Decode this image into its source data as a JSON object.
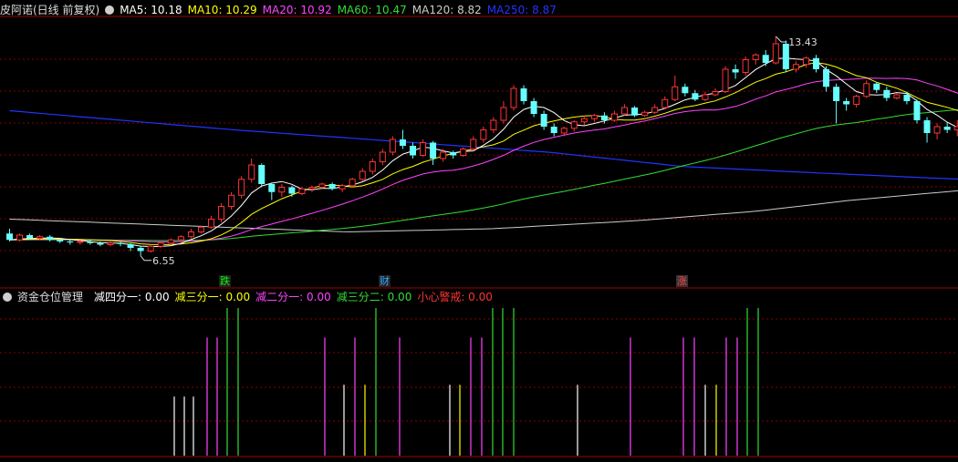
{
  "header": {
    "title": "皮阿诺(日线 前复权)",
    "gear_icon": "gear-icon",
    "ma_labels": [
      {
        "text": "MA5: 10.18",
        "color": "#ffffff"
      },
      {
        "text": "MA10: 10.29",
        "color": "#ffff00"
      },
      {
        "text": "MA20: 10.92",
        "color": "#ff44ff"
      },
      {
        "text": "MA60: 10.47",
        "color": "#33dd33"
      },
      {
        "text": "MA120: 8.82",
        "color": "#cccccc"
      },
      {
        "text": "MA250: 8.87",
        "color": "#2233ff"
      }
    ]
  },
  "price_annotations": {
    "high": "13.43",
    "low": "6.55"
  },
  "markers": [
    {
      "text": "跌",
      "color": "#00ff00",
      "bg": "#222"
    },
    {
      "text": "财",
      "color": "#33aaff",
      "bg": "#222"
    },
    {
      "text": "涨",
      "color": "#ff4444",
      "bg": "#333"
    }
  ],
  "indicator": {
    "title": "资金仓位管理",
    "values": [
      {
        "text": "减四分一: 0.00",
        "color": "#ffffff"
      },
      {
        "text": "减三分一: 0.00",
        "color": "#ffff00"
      },
      {
        "text": "减二分一: 0.00",
        "color": "#ff44ff"
      },
      {
        "text": "减三分二: 0.00",
        "color": "#33dd33"
      },
      {
        "text": "小心警戒: 0.00",
        "color": "#ff3333"
      }
    ]
  },
  "colors": {
    "up": "#ff3333",
    "down": "#66ffff",
    "grid": "#8b0000",
    "axis": "#a00000"
  },
  "chart_data": {
    "type": "candlestick",
    "y_range": [
      6.0,
      14.0
    ],
    "candles": [
      [
        7.25,
        7.05,
        7.4,
        7.0
      ],
      [
        7.05,
        7.2,
        7.25,
        7.0
      ],
      [
        7.2,
        7.1,
        7.25,
        7.05
      ],
      [
        7.1,
        7.15,
        7.2,
        7.05
      ],
      [
        7.15,
        7.05,
        7.2,
        7.0
      ],
      [
        7.05,
        7.0,
        7.1,
        6.95
      ],
      [
        7.0,
        6.98,
        7.05,
        6.9
      ],
      [
        6.98,
        7.0,
        7.05,
        6.9
      ],
      [
        7.0,
        6.95,
        7.05,
        6.9
      ],
      [
        6.95,
        6.9,
        7.0,
        6.85
      ],
      [
        6.9,
        6.95,
        7.0,
        6.85
      ],
      [
        6.95,
        6.92,
        7.0,
        6.85
      ],
      [
        6.92,
        6.8,
        6.95,
        6.7
      ],
      [
        6.8,
        6.7,
        6.85,
        6.55
      ],
      [
        6.7,
        6.85,
        6.9,
        6.65
      ],
      [
        6.85,
        6.95,
        7.0,
        6.8
      ],
      [
        6.95,
        7.05,
        7.1,
        6.9
      ],
      [
        7.05,
        7.15,
        7.2,
        7.0
      ],
      [
        7.15,
        7.3,
        7.4,
        7.1
      ],
      [
        7.3,
        7.45,
        7.5,
        7.25
      ],
      [
        7.45,
        7.7,
        7.8,
        7.4
      ],
      [
        7.7,
        8.1,
        8.2,
        7.6
      ],
      [
        8.1,
        8.45,
        8.55,
        8.0
      ],
      [
        8.45,
        8.95,
        9.05,
        8.35
      ],
      [
        8.95,
        9.4,
        9.6,
        8.85
      ],
      [
        9.4,
        8.8,
        9.45,
        8.7
      ],
      [
        8.8,
        8.55,
        8.85,
        8.3
      ],
      [
        8.55,
        8.7,
        8.8,
        8.4
      ],
      [
        8.7,
        8.5,
        8.75,
        8.4
      ],
      [
        8.5,
        8.65,
        8.7,
        8.45
      ],
      [
        8.65,
        8.7,
        8.75,
        8.55
      ],
      [
        8.7,
        8.8,
        8.85,
        8.65
      ],
      [
        8.8,
        8.65,
        8.85,
        8.6
      ],
      [
        8.65,
        8.75,
        8.8,
        8.55
      ],
      [
        8.75,
        8.95,
        9.0,
        8.7
      ],
      [
        8.95,
        9.2,
        9.3,
        8.9
      ],
      [
        9.2,
        9.5,
        9.6,
        9.1
      ],
      [
        9.5,
        9.8,
        9.9,
        9.4
      ],
      [
        9.8,
        10.2,
        10.3,
        9.7
      ],
      [
        10.2,
        10.0,
        10.5,
        9.9
      ],
      [
        10.0,
        9.7,
        10.1,
        9.6
      ],
      [
        9.7,
        10.1,
        10.2,
        9.65
      ],
      [
        10.1,
        9.6,
        10.15,
        9.4
      ],
      [
        9.6,
        9.8,
        9.9,
        9.5
      ],
      [
        9.8,
        9.7,
        9.85,
        9.6
      ],
      [
        9.7,
        9.9,
        9.95,
        9.65
      ],
      [
        9.9,
        10.2,
        10.3,
        9.85
      ],
      [
        10.2,
        10.5,
        10.6,
        10.1
      ],
      [
        10.5,
        10.8,
        10.9,
        10.4
      ],
      [
        10.8,
        11.2,
        11.4,
        10.7
      ],
      [
        11.2,
        11.8,
        11.9,
        11.1
      ],
      [
        11.8,
        11.4,
        11.9,
        11.3
      ],
      [
        11.4,
        11.0,
        11.5,
        10.9
      ],
      [
        11.0,
        10.6,
        11.1,
        10.5
      ],
      [
        10.6,
        10.4,
        10.7,
        10.3
      ],
      [
        10.4,
        10.55,
        10.6,
        10.3
      ],
      [
        10.55,
        10.75,
        10.8,
        10.45
      ],
      [
        10.75,
        10.85,
        10.95,
        10.65
      ],
      [
        10.85,
        10.95,
        11.0,
        10.75
      ],
      [
        10.95,
        10.8,
        11.05,
        10.7
      ],
      [
        10.8,
        11.0,
        11.1,
        10.75
      ],
      [
        11.0,
        11.2,
        11.3,
        10.95
      ],
      [
        11.2,
        10.95,
        11.25,
        10.9
      ],
      [
        10.95,
        11.05,
        11.1,
        10.9
      ],
      [
        11.05,
        11.2,
        11.3,
        11.0
      ],
      [
        11.2,
        11.45,
        11.55,
        11.15
      ],
      [
        11.45,
        11.85,
        12.2,
        11.4
      ],
      [
        11.85,
        11.65,
        11.95,
        11.55
      ],
      [
        11.65,
        11.45,
        11.75,
        11.4
      ],
      [
        11.45,
        11.6,
        11.7,
        11.4
      ],
      [
        11.6,
        11.7,
        11.8,
        11.55
      ],
      [
        11.7,
        12.4,
        12.5,
        11.65
      ],
      [
        12.4,
        12.3,
        12.55,
        12.1
      ],
      [
        12.3,
        12.7,
        12.8,
        12.2
      ],
      [
        12.7,
        12.85,
        12.9,
        12.55
      ],
      [
        12.85,
        12.6,
        13.0,
        12.5
      ],
      [
        12.6,
        13.2,
        13.43,
        12.55
      ],
      [
        13.2,
        12.4,
        13.3,
        12.3
      ],
      [
        12.4,
        12.55,
        12.65,
        12.3
      ],
      [
        12.55,
        12.75,
        12.8,
        12.45
      ],
      [
        12.75,
        12.4,
        12.85,
        12.3
      ],
      [
        12.4,
        11.85,
        12.5,
        11.7
      ],
      [
        11.85,
        11.4,
        11.95,
        10.7
      ],
      [
        11.4,
        11.3,
        11.5,
        11.1
      ],
      [
        11.3,
        11.55,
        11.6,
        11.2
      ],
      [
        11.55,
        11.95,
        12.05,
        11.5
      ],
      [
        11.95,
        11.75,
        12.0,
        11.65
      ],
      [
        11.75,
        11.5,
        11.85,
        11.4
      ],
      [
        11.5,
        11.6,
        11.65,
        11.45
      ],
      [
        11.6,
        11.4,
        11.7,
        11.3
      ],
      [
        11.4,
        10.8,
        11.45,
        10.7
      ],
      [
        10.8,
        10.4,
        10.9,
        10.1
      ],
      [
        10.4,
        10.6,
        10.7,
        10.2
      ],
      [
        10.6,
        10.5,
        10.75,
        10.4
      ],
      [
        10.5,
        10.6,
        10.8,
        10.3
      ],
      [
        10.6,
        10.75,
        10.85,
        10.4
      ],
      [
        10.75,
        10.55,
        10.8,
        10.4
      ],
      [
        10.55,
        10.45,
        10.7,
        10.2
      ],
      [
        10.45,
        10.65,
        10.8,
        10.4
      ]
    ],
    "ma250": [
      [
        0,
        11.1
      ],
      [
        50,
        10.5
      ],
      [
        100,
        10.0
      ],
      [
        120,
        9.8
      ],
      [
        150,
        9.35
      ],
      [
        180,
        9.15
      ],
      [
        220,
        8.9
      ]
    ],
    "ma120": [
      [
        0,
        7.7
      ],
      [
        70,
        7.3
      ],
      [
        100,
        7.4
      ],
      [
        130,
        7.65
      ],
      [
        155,
        7.95
      ],
      [
        175,
        8.3
      ],
      [
        190,
        8.5
      ],
      [
        205,
        8.7
      ]
    ],
    "ma60_start": 7.05,
    "indicator_bars": [
      [
        191,
        "#ffffff",
        10
      ],
      [
        202,
        "#ffffff",
        10
      ],
      [
        212,
        "#ffffff",
        10
      ],
      [
        227,
        "#ff44ff",
        20
      ],
      [
        238,
        "#ff44ff",
        20
      ],
      [
        249,
        "#33dd33",
        25
      ],
      [
        261,
        "#33dd33",
        25
      ],
      [
        356,
        "#ff44ff",
        20
      ],
      [
        377,
        "#ffffff",
        12
      ],
      [
        389,
        "#ff44ff",
        20
      ],
      [
        400,
        "#ffff00",
        12
      ],
      [
        412,
        "#33dd33",
        25
      ],
      [
        438,
        "#ff44ff",
        20
      ],
      [
        493,
        "#ffffff",
        12
      ],
      [
        504,
        "#ffff00",
        12
      ],
      [
        516,
        "#ff44ff",
        20
      ],
      [
        528,
        "#ff44ff",
        20
      ],
      [
        540,
        "#33dd33",
        25
      ],
      [
        551,
        "#33dd33",
        25
      ],
      [
        563,
        "#33dd33",
        25
      ],
      [
        633,
        "#ffffff",
        12
      ],
      [
        691,
        "#ff44ff",
        20
      ],
      [
        749,
        "#ff44ff",
        20
      ],
      [
        761,
        "#ff44ff",
        20
      ],
      [
        773,
        "#ffffff",
        12
      ],
      [
        785,
        "#ffff00",
        12
      ],
      [
        796,
        "#ff44ff",
        20
      ],
      [
        808,
        "#ff44ff",
        20
      ],
      [
        819,
        "#33dd33",
        25
      ],
      [
        831,
        "#33dd33",
        25
      ]
    ]
  }
}
